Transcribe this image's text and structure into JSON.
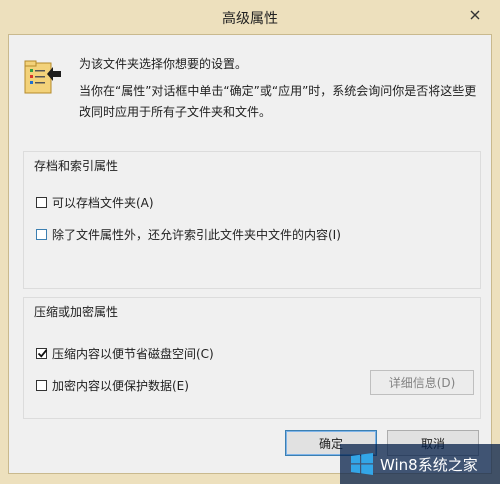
{
  "dialog": {
    "title": "高级属性"
  },
  "intro": {
    "line1": "为该文件夹选择你想要的设置。",
    "line2": "当你在“属性”对话框中单击“确定”或“应用”时，系统会询问你是否将这些更改同时应用于所有子文件夹和文件。"
  },
  "archive_group": {
    "title": "存档和索引属性",
    "option_archive": {
      "label": "可以存档文件夹(A)",
      "checked": false
    },
    "option_index": {
      "label": "除了文件属性外，还允许索引此文件夹中文件的内容(I)",
      "checked": false
    }
  },
  "compress_group": {
    "title": "压缩或加密属性",
    "option_compress": {
      "label": "压缩内容以便节省磁盘空间(C)",
      "checked": true
    },
    "option_encrypt": {
      "label": "加密内容以便保护数据(E)",
      "checked": false
    },
    "details_label": "详细信息(D)"
  },
  "buttons": {
    "ok": "确定",
    "cancel": "取消"
  },
  "watermark": {
    "text": "Win8系统之家"
  },
  "colors": {
    "frame": "#ede0bd",
    "client": "#f0f0f0",
    "focus": "#3c7fb1"
  }
}
